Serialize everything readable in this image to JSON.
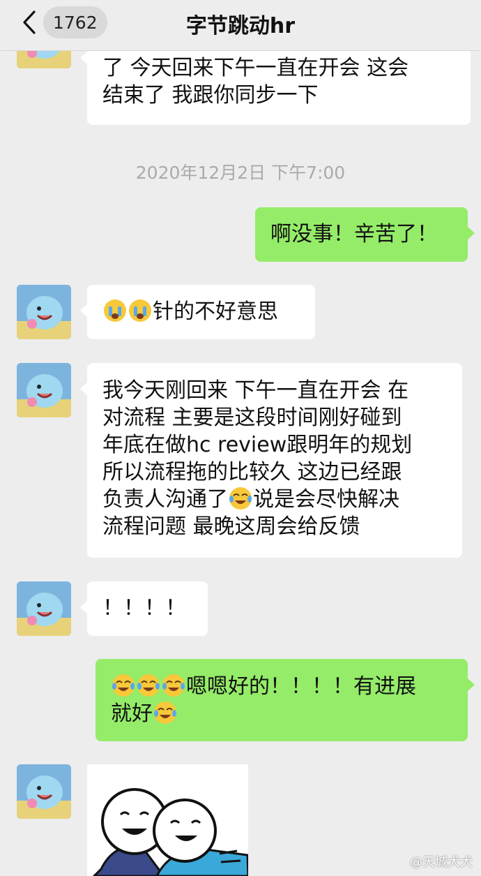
{
  "header": {
    "unread_count": "1762",
    "title": "字节跳动hr"
  },
  "colors": {
    "background": "#ededed",
    "incoming_bubble": "#ffffff",
    "outgoing_bubble": "#95ec69",
    "timestamp_text": "#aaaaaa"
  },
  "messages": [
    {
      "direction": "incoming",
      "lines": [
        "了 今天回来下午一直在开会 这会",
        "结束了 我跟你同步一下"
      ]
    },
    {
      "type": "timestamp",
      "text": "2020年12月2日 下午7:00"
    },
    {
      "direction": "outgoing",
      "text": "啊没事！辛苦了！"
    },
    {
      "direction": "incoming",
      "emoji": [
        "crying-face",
        "crying-face"
      ],
      "text": "针的不好意思"
    },
    {
      "direction": "incoming",
      "lines": [
        "我今天刚回来  下午一直在开会 在",
        "对流程 主要是这段时间刚好碰到",
        "年底在做hc review跟明年的规划",
        "所以流程拖的比较久 这边已经跟"
      ],
      "line5_before": "负责人沟通了",
      "line5_emoji": "crying-laughing-face",
      "line5_after": "说是会尽快解决",
      "line6": "流程问题 最晚这周会给反馈"
    },
    {
      "direction": "incoming",
      "text": "！！！！"
    },
    {
      "direction": "outgoing",
      "line1_emoji": [
        "crying-laughing-face",
        "crying-laughing-face",
        "crying-laughing-face"
      ],
      "line1_text": "嗯嗯好的！！！！有进展",
      "line2_text": "就好",
      "line2_emoji": "crying-laughing-face"
    },
    {
      "direction": "incoming",
      "type": "sticker",
      "sticker": "hugging-figures-sticker"
    }
  ],
  "watermark": "@天城犬犬"
}
